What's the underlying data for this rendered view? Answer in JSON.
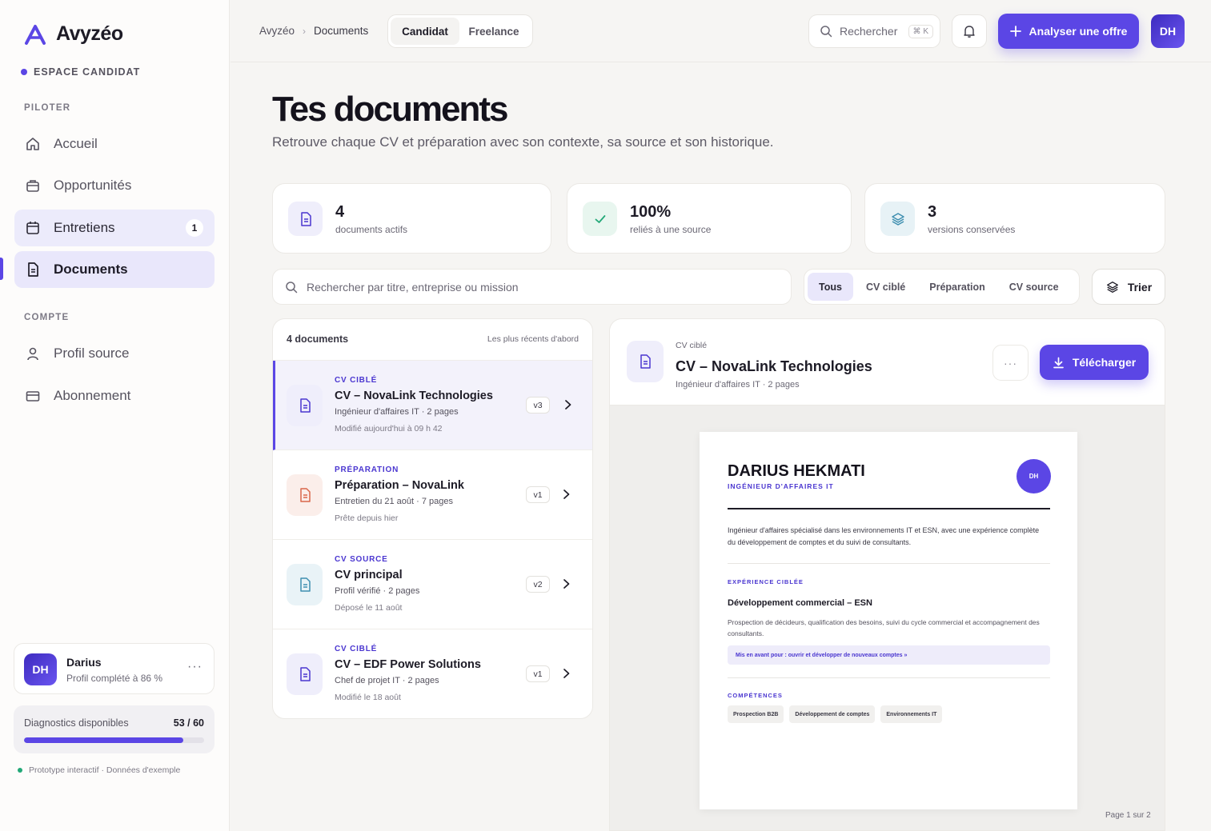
{
  "brand": {
    "name": "Avyzéo"
  },
  "sidebar": {
    "space_label": "ESPACE CANDIDAT",
    "section_pilot": "PILOTER",
    "section_account": "COMPTE",
    "items": [
      {
        "label": "Accueil",
        "icon": "home-icon"
      },
      {
        "label": "Opportunités",
        "icon": "briefcase-icon"
      },
      {
        "label": "Entretiens",
        "icon": "calendar-icon",
        "badge": "1"
      },
      {
        "label": "Documents",
        "icon": "document-icon"
      },
      {
        "label": "Profil source",
        "icon": "user-icon"
      },
      {
        "label": "Abonnement",
        "icon": "card-icon"
      }
    ],
    "profile": {
      "initials": "DH",
      "name": "Darius",
      "completion": "Profil complété à 86 %"
    },
    "diagnostics": {
      "label": "Diagnostics disponibles",
      "count": "53 / 60",
      "used": 53,
      "total": 60
    },
    "prototype_note": "Prototype interactif · Données d'exemple"
  },
  "topbar": {
    "breadcrumb": [
      "Avyzéo",
      "Documents"
    ],
    "segments": [
      "Candidat",
      "Freelance"
    ],
    "search_label": "Rechercher",
    "search_shortcut": "⌘ K",
    "cta_label": "Analyser une offre",
    "avatar_initials": "DH"
  },
  "page": {
    "title": "Tes documents",
    "subtitle": "Retrouve chaque CV et préparation avec son contexte, sa source et son historique."
  },
  "stats": [
    {
      "value": "4",
      "label": "documents actifs",
      "icon": "document-icon"
    },
    {
      "value": "100%",
      "label": "reliés à une source",
      "icon": "check-icon"
    },
    {
      "value": "3",
      "label": "versions conservées",
      "icon": "layers-icon"
    }
  ],
  "filters": {
    "search_placeholder": "Rechercher par titre, entreprise ou mission",
    "tabs": [
      "Tous",
      "CV ciblé",
      "Préparation",
      "CV source"
    ],
    "sort_label": "Trier"
  },
  "list": {
    "count": "4 documents",
    "sort": "Les plus récents d'abord",
    "items": [
      {
        "type": "CV CIBLÉ",
        "title": "CV – NovaLink Technologies",
        "meta": "Ingénieur d'affaires IT · 2 pages",
        "date": "Modifié aujourd'hui à 09 h 42",
        "version": "v3"
      },
      {
        "type": "PRÉPARATION",
        "title": "Préparation – NovaLink",
        "meta": "Entretien du 21 août · 7 pages",
        "date": "Prête depuis hier",
        "version": "v1"
      },
      {
        "type": "CV SOURCE",
        "title": "CV principal",
        "meta": "Profil vérifié · 2 pages",
        "date": "Déposé le 11 août",
        "version": "v2"
      },
      {
        "type": "CV CIBLÉ",
        "title": "CV – EDF Power Solutions",
        "meta": "Chef de projet IT · 2 pages",
        "date": "Modifié le 18 août",
        "version": "v1"
      }
    ]
  },
  "preview": {
    "type": "CV ciblé",
    "title": "CV – NovaLink Technologies",
    "meta": "Ingénieur d'affaires IT · 2 pages",
    "more": "···",
    "download_label": "Télécharger",
    "page_indicator": "Page 1 sur 2",
    "cv": {
      "name": "DARIUS HEKMATI",
      "role": "INGÉNIEUR D'AFFAIRES IT",
      "initials": "DH",
      "summary": "Ingénieur d'affaires spécialisé dans les environnements IT et ESN, avec une expérience complète du développement de comptes et du suivi de consultants.",
      "experience_heading": "EXPÉRIENCE CIBLÉE",
      "experience_title": "Développement commercial – ESN",
      "experience_desc": "Prospection de décideurs, qualification des besoins, suivi du cycle commercial et accompagnement des consultants.",
      "highlight": "Mis en avant pour : ouvrir et développer de nouveaux comptes »",
      "skills_heading": "COMPÉTENCES",
      "skills": [
        "Prospection B2B",
        "Développement de comptes",
        "Environnements IT"
      ]
    }
  },
  "colors": {
    "accent": "#5b46e5",
    "background": "#f6f5f3",
    "sidebar": "#fdfcfb",
    "success": "#22a877",
    "preparation": "#d9674a",
    "source": "#3f8fb0"
  }
}
